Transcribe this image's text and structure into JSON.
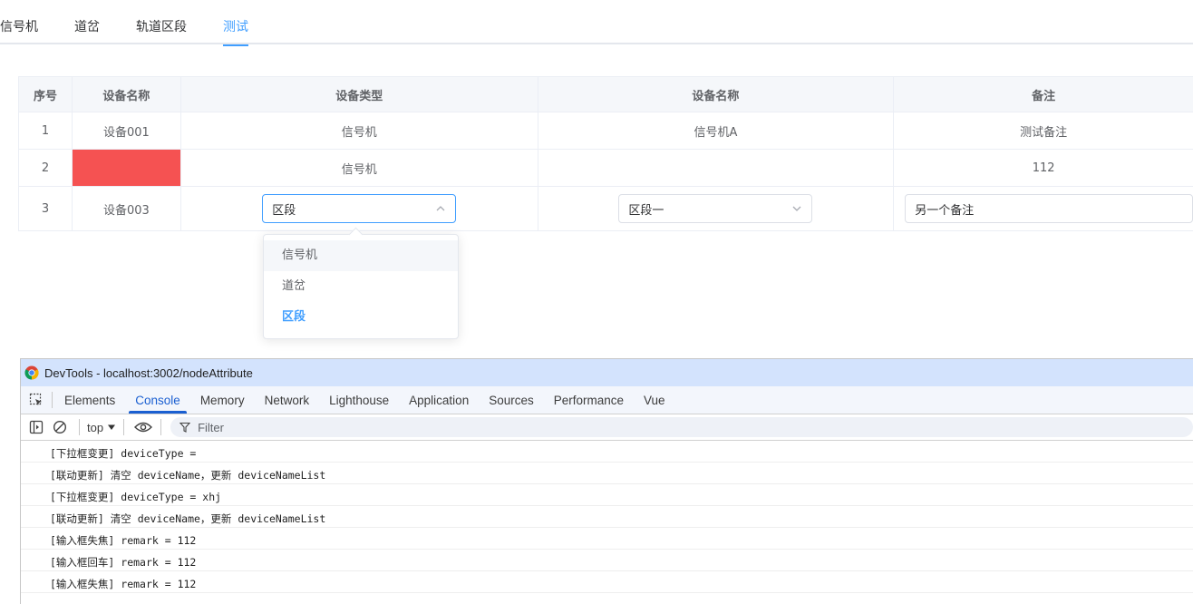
{
  "tabs": [
    {
      "label": "信号机",
      "active": false
    },
    {
      "label": "道岔",
      "active": false
    },
    {
      "label": "轨道区段",
      "active": false
    },
    {
      "label": "测试",
      "active": true
    }
  ],
  "table": {
    "headers": [
      "序号",
      "设备名称",
      "设备类型",
      "设备名称",
      "备注"
    ],
    "rows": [
      {
        "index": "1",
        "name": "设备001",
        "type": "信号机",
        "device_name": "信号机A",
        "remark": "测试备注"
      },
      {
        "index": "2",
        "name": "",
        "type": "信号机",
        "device_name": "",
        "remark": "112"
      },
      {
        "index": "3",
        "name": "设备003",
        "type_select": "区段",
        "device_name_select": "区段一",
        "remark_input": "另一个备注"
      }
    ],
    "highlight_color": "#f55252"
  },
  "dropdown": {
    "options": [
      "信号机",
      "道岔",
      "区段"
    ],
    "hovered": "信号机",
    "selected": "区段"
  },
  "devtools": {
    "title": "DevTools - localhost:3002/nodeAttribute",
    "tabs": [
      "Elements",
      "Console",
      "Memory",
      "Network",
      "Lighthouse",
      "Application",
      "Sources",
      "Performance",
      "Vue"
    ],
    "active_tab": "Console",
    "context": "top",
    "filter_placeholder": "Filter",
    "console_lines": [
      "[下拉框变更] deviceType =",
      "[联动更新] 清空 deviceName，更新 deviceNameList",
      "[下拉框变更] deviceType = xhj",
      "[联动更新] 清空 deviceName，更新 deviceNameList",
      "[输入框失焦] remark = 112",
      "[输入框回车] remark = 112",
      "[输入框失焦] remark = 112"
    ]
  },
  "colors": {
    "accent": "#409eff",
    "devtools_title_bg": "#d3e3fd",
    "devtools_active": "#1a5fd1"
  }
}
